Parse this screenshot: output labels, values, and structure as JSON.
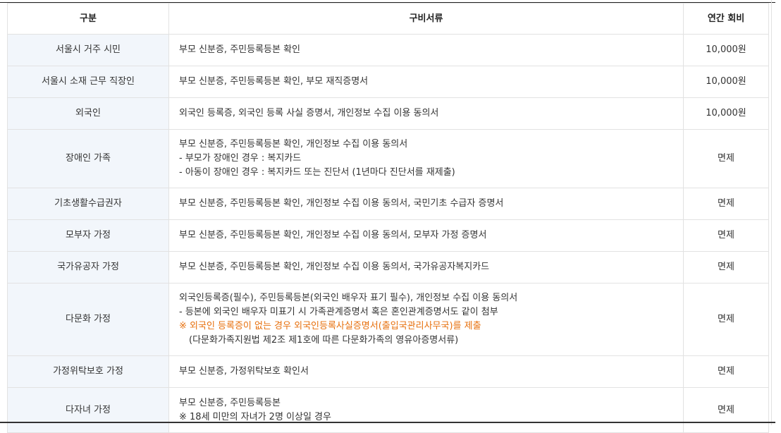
{
  "table": {
    "headers": {
      "category": "구분",
      "documents": "구비서류",
      "fee": "연간 회비"
    },
    "rows": [
      {
        "category": "서울시 거주 시민",
        "docs": [
          "부모 신분증, 주민등록등본 확인"
        ],
        "fee": "10,000원"
      },
      {
        "category": "서울시 소재 근무 직장인",
        "docs": [
          "부모 신분증, 주민등록등본 확인, 부모 재직증명서"
        ],
        "fee": "10,000원"
      },
      {
        "category": "외국인",
        "docs": [
          "외국인 등록증, 외국인 등록 사실 증명서, 개인정보 수집 이용 동의서"
        ],
        "fee": "10,000원"
      },
      {
        "category": "장애인 가족",
        "docs": [
          "부모 신분증, 주민등록등본 확인, 개인정보 수집 이용 동의서",
          "-  부모가 장애인 경우 : 복지카드",
          "-  아동이 장애인 경우 : 복지카드 또는 진단서 (1년마다 진단서를 재제출)"
        ],
        "fee": "면제"
      },
      {
        "category": "기초생활수급권자",
        "docs": [
          "부모 신분증, 주민등록등본 확인, 개인정보 수집 이용 동의서, 국민기초 수급자 증명서"
        ],
        "fee": "면제"
      },
      {
        "category": "모부자 가정",
        "docs": [
          "부모 신분증, 주민등록등본 확인, 개인정보 수집 이용 동의서, 모부자 가정 증명서"
        ],
        "fee": "면제"
      },
      {
        "category": "국가유공자 가정",
        "docs": [
          "부모 신분증, 주민등록등본 확인, 개인정보 수집 이용 동의서, 국가유공자복지카드"
        ],
        "fee": "면제"
      },
      {
        "category": "다문화 가정",
        "docs": [
          "외국인등록증(필수), 주민등록등본(외국인 배우자 표기 필수), 개인정보 수집 이용 동의서",
          "-  등본에 외국인 배우자 미표기 시 가족관계증명서 혹은 혼인관계증명서도 같이 첨부",
          "※ 외국인 등록증이 없는 경우 외국인등록사실증명서(출입국관리사무국)를 제출",
          "(다문화가족지원법 제2조 제1호에 따른 다문화가족의 영유아증명서류)"
        ],
        "fee": "면제"
      },
      {
        "category": "가정위탁보호 가정",
        "docs": [
          "부모 신분증, 가정위탁보호 확인서"
        ],
        "fee": "면제"
      },
      {
        "category": "다자녀 가정",
        "docs": [
          "부모 신분증, 주민등록등본",
          "※ 18세 미만의 자녀가 2명 이상일 경우"
        ],
        "fee": "면제"
      }
    ]
  },
  "colors": {
    "category_bg": "#f2f6fb",
    "note_text": "#e7700d",
    "border": "#e2e2e2"
  }
}
